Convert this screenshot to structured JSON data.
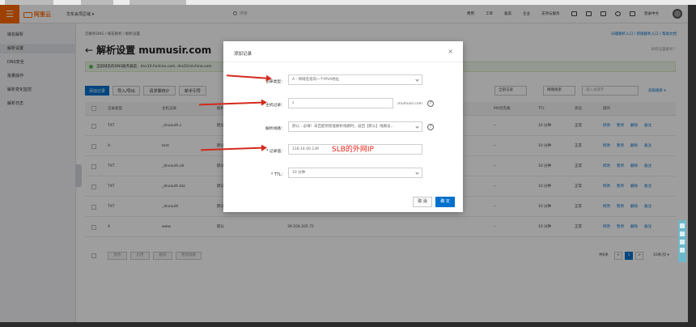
{
  "header": {
    "menu_icon": "☰",
    "logo": "阿里云",
    "region": "华东会员区域 ▾",
    "search_placeholder": "搜索",
    "nav": [
      "费用",
      "工单",
      "备案",
      "企业",
      "支持与服务"
    ],
    "user": "登录中文"
  },
  "sidebar": {
    "items": [
      "域名解析",
      "解析设置",
      "DNS安全",
      "批量操作",
      "解析变化监控",
      "解析日志"
    ],
    "active_index": 1
  },
  "main": {
    "breadcrumb": "云解析DNS / 域名解析 / 解析设置",
    "top_link": "旧版解析入口 / 新版解析入口 / 帮助文档",
    "back_arrow": "←",
    "title": "解析设置 mumusir.com",
    "help_link": "如何设置解析？",
    "notice": "当前域名的DNS服务器是：dns10.hichina.com, dns10.hichina.com",
    "buttons": [
      "添加记录",
      "导入/导出",
      "请求量统计",
      "新手引导"
    ],
    "filters": [
      "全部记录",
      "精确搜索",
      "输入关键字"
    ],
    "advanced_search": "高级搜索 ▾",
    "columns": [
      "记录类型",
      "主机记录",
      "解析线路",
      "记录值",
      "MX优先级",
      "TTL",
      "状态",
      "操作"
    ],
    "rows": [
      {
        "type": "TXT",
        "host": "_dnsauth.c",
        "line": "默认",
        "value": "",
        "mx": "--",
        "ttl": "10 分钟",
        "status": "正常",
        "ops": [
          "修改",
          "暂停",
          "删除",
          "备注"
        ]
      },
      {
        "type": "A",
        "host": "test",
        "line": "默认",
        "value": "",
        "mx": "--",
        "ttl": "10 分钟",
        "status": "正常",
        "ops": [
          "修改",
          "暂停",
          "删除",
          "备注"
        ]
      },
      {
        "type": "TXT",
        "host": "_dnsauth.all",
        "line": "默认",
        "value": "",
        "mx": "--",
        "ttl": "10 分钟",
        "status": "正常",
        "ops": [
          "修改",
          "暂停",
          "删除",
          "备注"
        ]
      },
      {
        "type": "TXT",
        "host": "_dnsauth.blo",
        "line": "默认",
        "value": "",
        "mx": "--",
        "ttl": "10 分钟",
        "status": "正常",
        "ops": [
          "修改",
          "暂停",
          "删除",
          "备注"
        ]
      },
      {
        "type": "TXT",
        "host": "_dnsauth",
        "line": "默认",
        "value": "",
        "mx": "--",
        "ttl": "10 分钟",
        "status": "正常",
        "ops": [
          "修改",
          "暂停",
          "删除",
          "备注"
        ]
      },
      {
        "type": "A",
        "host": "www",
        "line": "默认",
        "value": "39.104.205.72",
        "mx": "--",
        "ttl": "10 分钟",
        "status": "正常",
        "ops": [
          "修改",
          "暂停",
          "删除",
          "备注"
        ]
      }
    ],
    "bottom_buttons": [
      "暂停",
      "启用",
      "删除",
      "更改线路"
    ],
    "pagination": {
      "total": "共6条",
      "prev": "<",
      "current": "1",
      "next": ">",
      "page_size": "10条/页 ▾"
    }
  },
  "modal": {
    "title": "添加记录",
    "close_icon": "×",
    "fields": [
      {
        "label": "记录类型：",
        "value": "A - 将域名指向一个IPV4地址"
      },
      {
        "label": "主机记录：",
        "value": "s",
        "suffix": ".mumusir.com"
      },
      {
        "label": "解析线路：",
        "value": "默认 - 必填！未匹配到智能解析线路时，返回【默认】线路设..."
      },
      {
        "label": "* 记录值：",
        "value": "116.14.40.139"
      },
      {
        "label": "* TTL：",
        "value": "10 分钟"
      }
    ],
    "cancel": "取 消",
    "confirm": "确 定"
  },
  "annotation": {
    "text": "SLB的外网IP",
    "color": "#e8251b"
  },
  "colors": {
    "accent": "#ff6a00",
    "primary": "#0070cc",
    "link": "#0070cc",
    "arrow": "#d42a1e"
  }
}
